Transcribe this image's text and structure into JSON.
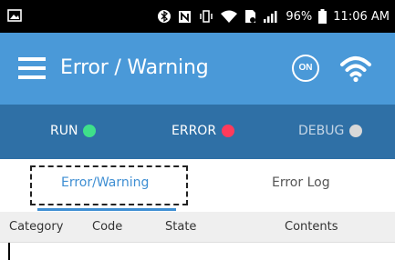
{
  "status_bar": {
    "battery_percent": "96%",
    "time": "11:06 AM"
  },
  "app_bar": {
    "title": "Error / Warning",
    "on_label": "ON"
  },
  "status_indicators": [
    {
      "label": "RUN",
      "color": "#3fe08a"
    },
    {
      "label": "ERROR",
      "color": "#ff3b5c"
    },
    {
      "label": "DEBUG",
      "color": "#d8d8d8"
    }
  ],
  "tabs": [
    {
      "label": "Error/Warning",
      "active": true
    },
    {
      "label": "Error Log",
      "active": false
    }
  ],
  "table": {
    "columns": [
      "Category",
      "Code",
      "State",
      "Contents"
    ],
    "rows": []
  },
  "colors": {
    "app_bar": "#4a99d8",
    "status_row": "#2f70a6",
    "accent": "#3f8fd3"
  }
}
